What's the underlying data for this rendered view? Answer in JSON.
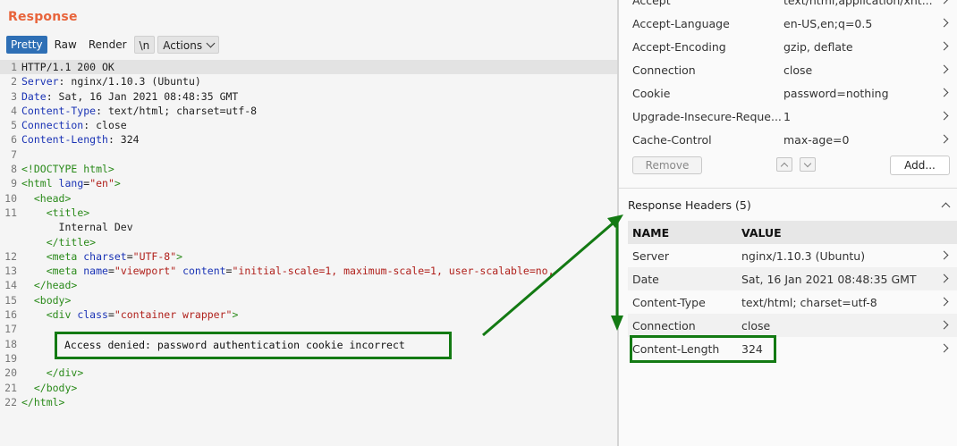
{
  "response": {
    "title": "Response",
    "tabs": [
      {
        "label": "Pretty",
        "active": true
      },
      {
        "label": "Raw"
      },
      {
        "label": "Render"
      },
      {
        "label": "\\n"
      },
      {
        "label": "Actions"
      }
    ]
  },
  "code": {
    "lines": [
      {
        "n": "1",
        "segs": [
          [
            "t",
            "HTTP/1.1 200 OK"
          ]
        ]
      },
      {
        "n": "2",
        "segs": [
          [
            "hk",
            "Server"
          ],
          [
            "t",
            ": nginx/1.10.3 (Ubuntu)"
          ]
        ]
      },
      {
        "n": "3",
        "segs": [
          [
            "hk",
            "Date"
          ],
          [
            "t",
            ": Sat, 16 Jan 2021 08:48:35 GMT"
          ]
        ]
      },
      {
        "n": "4",
        "segs": [
          [
            "hk",
            "Content-Type"
          ],
          [
            "t",
            ": text/html; charset=utf-8"
          ]
        ]
      },
      {
        "n": "5",
        "segs": [
          [
            "hk",
            "Connection"
          ],
          [
            "t",
            ": close"
          ]
        ]
      },
      {
        "n": "6",
        "segs": [
          [
            "hk",
            "Content-Length"
          ],
          [
            "t",
            ": 324"
          ]
        ]
      },
      {
        "n": "7",
        "segs": []
      },
      {
        "n": "8",
        "segs": [
          [
            "tag",
            "<!DOCTYPE html>"
          ]
        ]
      },
      {
        "n": "9",
        "segs": [
          [
            "tag",
            "<html "
          ],
          [
            "attr",
            "lang"
          ],
          [
            "t",
            "="
          ],
          [
            "str",
            "\"en\""
          ],
          [
            "tag",
            ">"
          ]
        ]
      },
      {
        "n": "10",
        "segs": [
          [
            "t",
            "  "
          ],
          [
            "tag",
            "<head>"
          ]
        ]
      },
      {
        "n": "11",
        "segs": [
          [
            "t",
            "    "
          ],
          [
            "tag",
            "<title>"
          ]
        ]
      },
      {
        "n": "",
        "segs": [
          [
            "t",
            "      Internal Dev"
          ]
        ]
      },
      {
        "n": "",
        "segs": [
          [
            "t",
            "    "
          ],
          [
            "tag",
            "</title>"
          ]
        ]
      },
      {
        "n": "12",
        "segs": [
          [
            "t",
            "    "
          ],
          [
            "tag",
            "<meta "
          ],
          [
            "attr",
            "charset"
          ],
          [
            "t",
            "="
          ],
          [
            "str",
            "\"UTF-8\""
          ],
          [
            "tag",
            ">"
          ]
        ]
      },
      {
        "n": "13",
        "segs": [
          [
            "t",
            "    "
          ],
          [
            "tag",
            "<meta "
          ],
          [
            "attr",
            "name"
          ],
          [
            "t",
            "="
          ],
          [
            "str",
            "\"viewport\""
          ],
          [
            "t",
            " "
          ],
          [
            "attr",
            "content"
          ],
          [
            "t",
            "="
          ],
          [
            "str",
            "\"initial-scale=1, maximum-scale=1, user-scalable=no,"
          ]
        ]
      },
      {
        "n": "14",
        "segs": [
          [
            "t",
            "  "
          ],
          [
            "tag",
            "</head>"
          ]
        ]
      },
      {
        "n": "15",
        "segs": [
          [
            "t",
            "  "
          ],
          [
            "tag",
            "<body>"
          ]
        ]
      },
      {
        "n": "16",
        "segs": [
          [
            "t",
            "    "
          ],
          [
            "tag",
            "<div "
          ],
          [
            "attr",
            "class"
          ],
          [
            "t",
            "="
          ],
          [
            "str",
            "\"container wrapper\""
          ],
          [
            "tag",
            ">"
          ]
        ]
      },
      {
        "n": "17",
        "segs": []
      },
      {
        "n": "18",
        "segs": []
      },
      {
        "n": "19",
        "segs": []
      },
      {
        "n": "20",
        "segs": [
          [
            "t",
            "    "
          ],
          [
            "tag",
            "</div>"
          ]
        ]
      },
      {
        "n": "21",
        "segs": [
          [
            "t",
            "  "
          ],
          [
            "tag",
            "</body>"
          ]
        ]
      },
      {
        "n": "22",
        "segs": [
          [
            "tag",
            "</html>"
          ]
        ]
      }
    ],
    "callout": "Access denied: password authentication cookie incorrect"
  },
  "request_headers": {
    "rows": [
      {
        "name": "Accept",
        "value": "text/html,application/xht..."
      },
      {
        "name": "Accept-Language",
        "value": "en-US,en;q=0.5"
      },
      {
        "name": "Accept-Encoding",
        "value": "gzip, deflate"
      },
      {
        "name": "Connection",
        "value": "close"
      },
      {
        "name": "Cookie",
        "value": "password=nothing"
      },
      {
        "name": "Upgrade-Insecure-Reque...",
        "value": "1"
      },
      {
        "name": "Cache-Control",
        "value": "max-age=0"
      }
    ],
    "remove_label": "Remove",
    "add_label": "Add..."
  },
  "response_headers": {
    "title": "Response Headers (5)",
    "col_name": "NAME",
    "col_value": "VALUE",
    "rows": [
      {
        "name": "Server",
        "value": "nginx/1.10.3 (Ubuntu)"
      },
      {
        "name": "Date",
        "value": "Sat, 16 Jan 2021 08:48:35 GMT"
      },
      {
        "name": "Content-Type",
        "value": "text/html; charset=utf-8"
      },
      {
        "name": "Connection",
        "value": "close"
      },
      {
        "name": "Content-Length",
        "value": "324"
      }
    ]
  },
  "colors": {
    "accent": "#e8643b",
    "annotation": "#137a13",
    "active_tab": "#2e6fb5"
  }
}
